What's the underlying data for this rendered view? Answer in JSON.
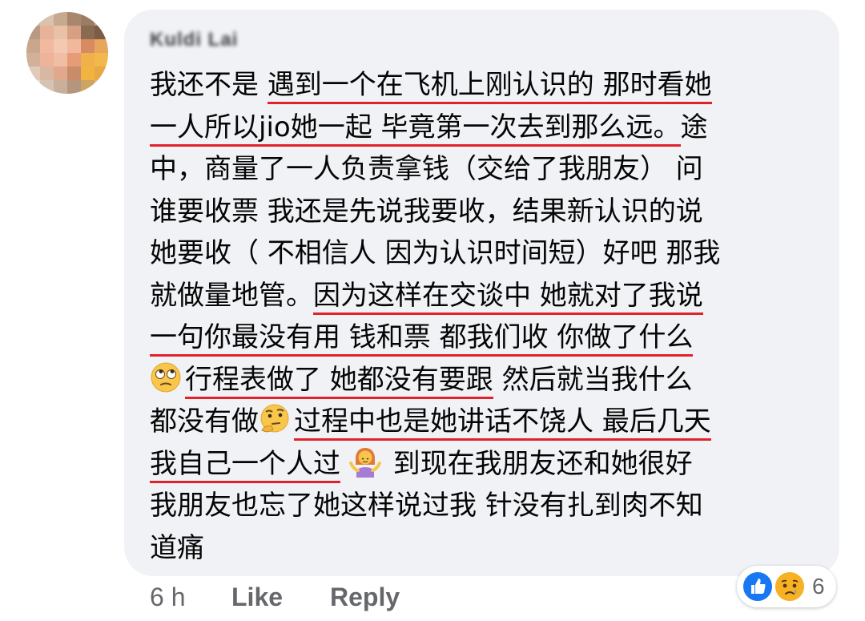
{
  "comment": {
    "author": "Kuldi Lai",
    "lines": [
      [
        "我还不是 ",
        "遇到一个在飞机上刚认识的 那时看她"
      ],
      [
        "一人所以jio她一起 毕竟第一次去到那么远。",
        "途"
      ],
      [
        "中，商量了一人负责拿钱（交给了我朋友） 问"
      ],
      [
        "谁要收票 我还是先说我要收，结果新认识的说"
      ],
      [
        "她要收（ 不相信人 因为认识时间短）好吧 那我"
      ],
      [
        "就做量地管。",
        "因为这样在交谈中 她就对了我说"
      ],
      [
        "一句你最没有用 钱和票 都我们收 你做了什么"
      ],
      [
        "行程表做了 她都没有要跟",
        " 然后就当我什么"
      ],
      [
        "都没有做",
        "过程中也是她讲话不饶人 最后几天"
      ],
      [
        "我自己一个人过",
        " 到现在我朋友还和她很好"
      ],
      [
        "我朋友也忘了她这样说过我 针没有扎到肉不知"
      ],
      [
        "道痛"
      ]
    ]
  },
  "emojis": {
    "eye_roll": "face-with-rolling-eyes-icon",
    "thinking": "thinking-face-icon",
    "shrug": "woman-shrugging-icon"
  },
  "meta": {
    "time": "6 h",
    "like_label": "Like",
    "reply_label": "Reply"
  },
  "reactions": {
    "count": "6",
    "types": [
      "like",
      "sad"
    ]
  },
  "colors": {
    "bubble": "#f0f2f5",
    "underline": "#e0222c",
    "meta_text": "#65676b",
    "like_blue": "#1877f2",
    "sad_yellow": "#f7b125"
  }
}
